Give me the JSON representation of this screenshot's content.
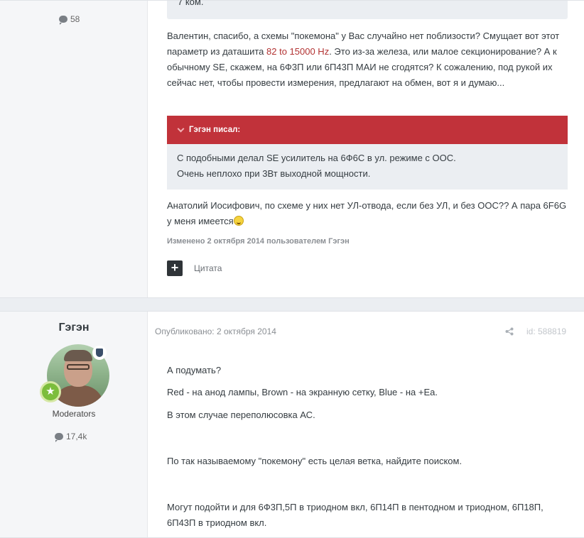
{
  "post1": {
    "author": {
      "post_count": "58"
    },
    "quote_top_text": "7 ком.",
    "reply_paragraph": {
      "part1": "Валентин, спасибо, а схемы \"покемона\" у Вас случайно нет поблизости? Смущает вот этот параметр из даташита ",
      "highlight": "82 to 15000 Hz",
      "part2": ". Это из-за железа, или малое секционирование? А к обычному SE, скажем, на 6Ф3П или 6П43П МАИ не сгодятся? К сожалению, под рукой их сейчас нет, чтобы провести измерения, предлагают на обмен, вот я и думаю..."
    },
    "quote": {
      "header": "Гэгэн писал:",
      "line1": "С подобными делал SE усилитель на 6Ф6С в ул. режиме с ООС.",
      "line2": "Очень неплохо при 3Вт выходной мощности."
    },
    "reply2": "Анатолий Иосифович, по схеме у них нет УЛ-отвода, если без УЛ, и без ООС?? А пара 6F6G у меня имеется",
    "edited": "Изменено 2 октября 2014 пользователем Гэгэн",
    "multiquote_icon": "+",
    "quote_button": "Цитата"
  },
  "post2": {
    "author": {
      "name": "Гэгэн",
      "group": "Moderators",
      "post_count": "17,4k",
      "rank_icon": "★"
    },
    "published": "Опубликовано: 2 октября 2014",
    "post_id": "id: 588819",
    "paragraphs": [
      "А подумать?",
      "Red - на анод лампы, Brown - на экранную сетку, Blue - на +Ea.",
      "В этом случае переполюсовка АС.",
      "По так называемому \"покемону\" есть целая ветка, найдите поиском.",
      "Могут подойти и для 6Ф3П,5П в триодном вкл, 6П14П в пентодном и триодном, 6П18П, 6П43П в триодном вкл."
    ]
  },
  "colors": {
    "quote_header": "#c1323a",
    "highlight": "#b23232",
    "quote_bg": "#ebeef2"
  }
}
